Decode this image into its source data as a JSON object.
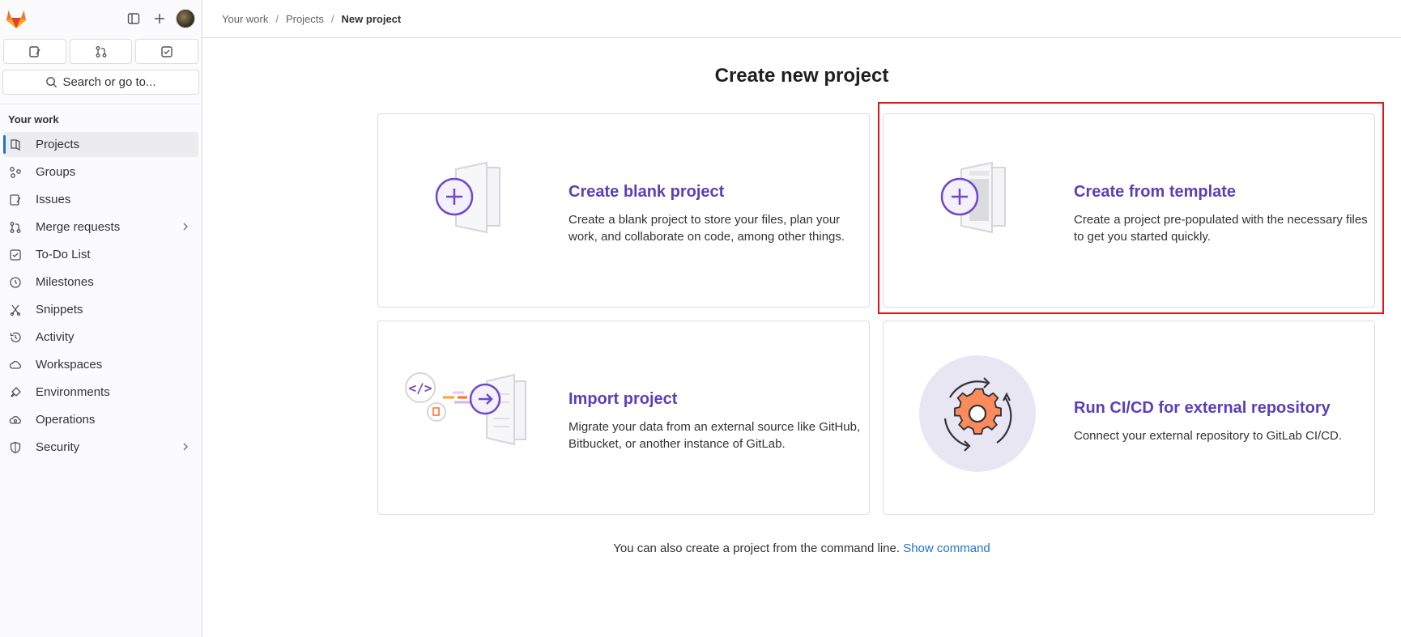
{
  "breadcrumb": [
    "Your work",
    "Projects",
    "New project"
  ],
  "sidebar": {
    "search_label": "Search or go to...",
    "section": "Your work",
    "items": [
      {
        "label": "Projects",
        "icon": "project-icon",
        "active": true
      },
      {
        "label": "Groups",
        "icon": "group-icon"
      },
      {
        "label": "Issues",
        "icon": "issues-icon"
      },
      {
        "label": "Merge requests",
        "icon": "merge-request-icon",
        "chevron": true
      },
      {
        "label": "To-Do List",
        "icon": "todo-icon"
      },
      {
        "label": "Milestones",
        "icon": "milestone-icon"
      },
      {
        "label": "Snippets",
        "icon": "snippet-icon"
      },
      {
        "label": "Activity",
        "icon": "history-icon"
      },
      {
        "label": "Workspaces",
        "icon": "cloud-icon"
      },
      {
        "label": "Environments",
        "icon": "environment-icon"
      },
      {
        "label": "Operations",
        "icon": "operations-icon"
      },
      {
        "label": "Security",
        "icon": "shield-icon",
        "chevron": true
      }
    ]
  },
  "main": {
    "title": "Create new project",
    "cards": [
      {
        "title": "Create blank project",
        "desc": "Create a blank project to store your files, plan your work, and collaborate on code, among other things."
      },
      {
        "title": "Create from template",
        "desc": "Create a project pre-populated with the necessary files to get you started quickly."
      },
      {
        "title": "Import project",
        "desc": "Migrate your data from an external source like GitHub, Bitbucket, or another instance of GitLab."
      },
      {
        "title": "Run CI/CD for external repository",
        "desc": "Connect your external repository to GitLab CI/CD."
      }
    ],
    "footer_text": "You can also create a project from the command line.",
    "footer_link": "Show command"
  },
  "colors": {
    "accent": "#5a3fb8",
    "link": "#1f75cb",
    "highlight": "#e0151b"
  }
}
